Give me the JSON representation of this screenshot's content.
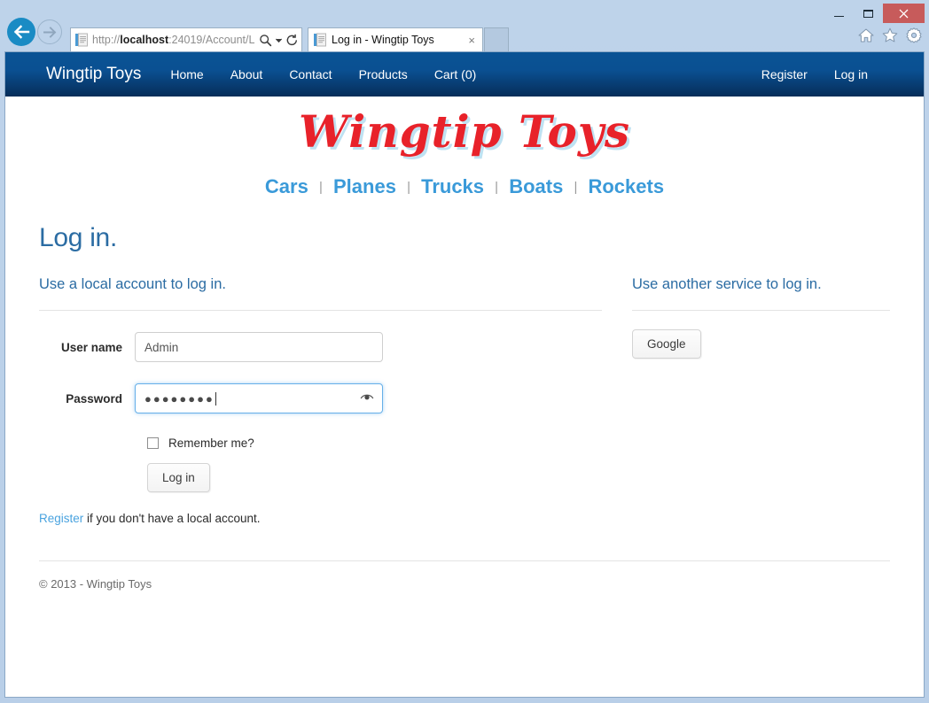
{
  "browser": {
    "back_label": "Back",
    "forward_label": "Forward",
    "url": "http://localhost:24019/Account/L",
    "url_bold": "localhost",
    "url_prefix": "http://",
    "url_suffix": ":24019/Account/L",
    "search_icon": "search-icon",
    "dropdown_icon": "chevron-down-icon",
    "refresh_icon": "refresh-icon",
    "tab_title": "Log in - Wingtip Toys",
    "tab_close": "×",
    "window_minimize": "–",
    "window_maximize": "□",
    "window_close": "×",
    "toolbar_icons": [
      "home-icon",
      "favorites-star-icon",
      "settings-gear-icon"
    ]
  },
  "sitenav": {
    "brand": "Wingtip Toys",
    "links": [
      {
        "label": "Home"
      },
      {
        "label": "About"
      },
      {
        "label": "Contact"
      },
      {
        "label": "Products"
      },
      {
        "label": "Cart (0)"
      }
    ],
    "right_links": [
      {
        "label": "Register"
      },
      {
        "label": "Log in"
      }
    ]
  },
  "header": {
    "logo_text": "Wingtip Toys",
    "logo_color": "#e8222a",
    "logo_shadow_color": "#bfe2f2",
    "categories": [
      {
        "label": "Cars"
      },
      {
        "label": "Planes"
      },
      {
        "label": "Trucks"
      },
      {
        "label": "Boats"
      },
      {
        "label": "Rockets"
      }
    ],
    "category_separator": "|",
    "category_color": "#3a9ad9"
  },
  "main": {
    "page_title": "Log in.",
    "local": {
      "heading": "Use a local account to log in.",
      "username_label": "User name",
      "username_value": "Admin",
      "password_label": "Password",
      "password_value": "●●●●●●●●",
      "password_reveal_icon": "reveal-password-eye-icon",
      "remember_label": "Remember me?",
      "remember_checked": false,
      "login_button": "Log in",
      "register_link": "Register",
      "register_text": " if you don't have a local account."
    },
    "external": {
      "heading": "Use another service to log in.",
      "providers": [
        {
          "label": "Google"
        }
      ]
    }
  },
  "footer": {
    "copyright": "© 2013 - Wingtip Toys"
  }
}
